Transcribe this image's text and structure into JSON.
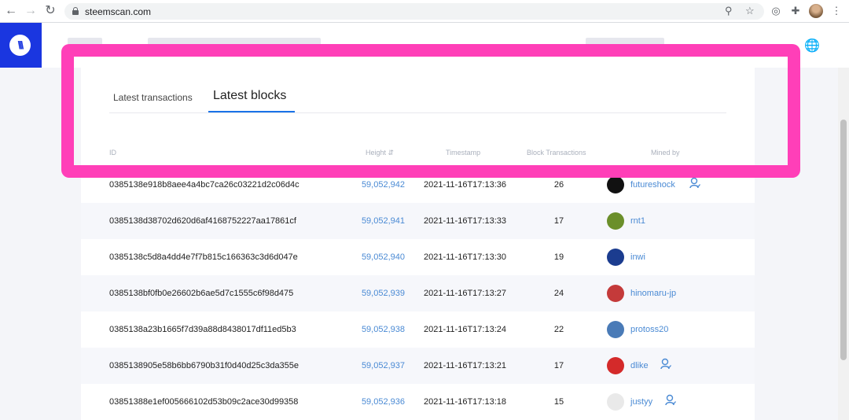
{
  "browser": {
    "url": "steemscan.com"
  },
  "tabs": {
    "transactions": "Latest transactions",
    "blocks": "Latest blocks"
  },
  "table": {
    "headers": {
      "id": "ID",
      "height": "Height",
      "timestamp": "Timestamp",
      "block_transactions": "Block Transactions",
      "mined_by": "Mined by"
    },
    "rows": [
      {
        "id": "0385138e918b8aee4a4bc7ca26c03221d2c06d4c",
        "height": "59,052,942",
        "timestamp": "2021-11-16T17:13:36",
        "tx": "26",
        "miner": "futureshock",
        "avatar": "#111111",
        "badge": true
      },
      {
        "id": "0385138d38702d620d6af4168752227aa17861cf",
        "height": "59,052,941",
        "timestamp": "2021-11-16T17:13:33",
        "tx": "17",
        "miner": "rnt1",
        "avatar": "#6b8f2a",
        "badge": false
      },
      {
        "id": "0385138c5d8a4dd4e7f7b815c166363c3d6d047e",
        "height": "59,052,940",
        "timestamp": "2021-11-16T17:13:30",
        "tx": "19",
        "miner": "inwi",
        "avatar": "#1b3c8f",
        "badge": false
      },
      {
        "id": "0385138bf0fb0e26602b6ae5d7c1555c6f98d475",
        "height": "59,052,939",
        "timestamp": "2021-11-16T17:13:27",
        "tx": "24",
        "miner": "hinomaru-jp",
        "avatar": "#c43a3a",
        "badge": false
      },
      {
        "id": "0385138a23b1665f7d39a88d8438017df11ed5b3",
        "height": "59,052,938",
        "timestamp": "2021-11-16T17:13:24",
        "tx": "22",
        "miner": "protoss20",
        "avatar": "#4a7bb7",
        "badge": false
      },
      {
        "id": "0385138905e58b6bb6790b31f0d40d25c3da355e",
        "height": "59,052,937",
        "timestamp": "2021-11-16T17:13:21",
        "tx": "17",
        "miner": "dlike",
        "avatar": "#d42a2a",
        "badge": true
      },
      {
        "id": "03851388e1ef005666102d53b09c2ace30d99358",
        "height": "59,052,936",
        "timestamp": "2021-11-16T17:13:18",
        "tx": "15",
        "miner": "justyy",
        "avatar": "#e9e9e9",
        "badge": true
      }
    ]
  },
  "colors": {
    "highlight": "#ff3fb8",
    "logo_bg": "#1a36e0",
    "link": "#4a8ad4"
  }
}
